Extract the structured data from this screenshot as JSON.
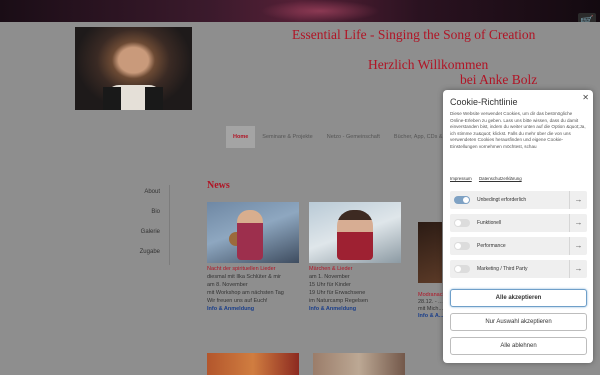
{
  "site": {
    "title": "Essential Life - Singing the Song of Creation",
    "welcome_1": "Herzlich Willkommen",
    "welcome_2": "bei Anke Bolz"
  },
  "main_nav": [
    "Home",
    "Seminare & Projekte",
    "Netzo - Gemeinschaft",
    "Bücher, App, CDs & mehr"
  ],
  "side_nav": [
    "About",
    "Bio",
    "Galerie",
    "Zugabe"
  ],
  "news": {
    "title": "News",
    "cards": [
      {
        "title": "Nacht der spirituellen Lieder",
        "lines": [
          "diesmal mit Ilka Schlüter & mir",
          "am 8. November",
          "mit Workshop am nächsten Tag",
          "Wir freuen uns auf Euch!"
        ],
        "link": "Info & Anmeldung"
      },
      {
        "title": "Märchen & Lieder",
        "lines": [
          "am 1. November",
          "15 Uhr für Kinder",
          "19 Uhr für Erwachsene",
          "im Naturcamp Regelsen"
        ],
        "link": "Info & Anmeldung"
      },
      {
        "title": "Modranacht & Silvester",
        "lines": [
          "28.12. - ...",
          "mit Mich..."
        ],
        "link": "Info & A..."
      }
    ]
  },
  "cookie": {
    "title": "Cookie-Richtlinie",
    "text": "Diese Website verwendet Cookies, um dir das bestmögliche Online-Erleben zu geben. Lass uns bitte wissen, dass du damit einverstanden bist, indem du weiter unten auf die Option &quot;Ja, ich stimme zu&quot; klickst. Falls du mehr über die von uns verwendeten Cookies herausfinden und eigene Cookie-Einstellungen vornehmen möchtest, schau",
    "links": [
      "Impressum",
      "Datenschutzerklärung"
    ],
    "categories": [
      {
        "label": "Unbedingt erforderlich",
        "on": true
      },
      {
        "label": "Funktionell",
        "on": false
      },
      {
        "label": "Performance",
        "on": false
      },
      {
        "label": "Marketing / Third Party",
        "on": false
      }
    ],
    "buttons": {
      "accept_all": "Alle akzeptieren",
      "accept_selected": "Nur Auswahl akzeptieren",
      "reject_all": "Alle ablehnen"
    }
  },
  "icons": {
    "cart": "shopping-cart-icon",
    "close": "close-icon",
    "arrow": "arrow-right-icon"
  },
  "colors": {
    "brand_red": "#b01425",
    "link_blue": "#1a3e8a",
    "toggle_on": "#7fa2c4"
  }
}
